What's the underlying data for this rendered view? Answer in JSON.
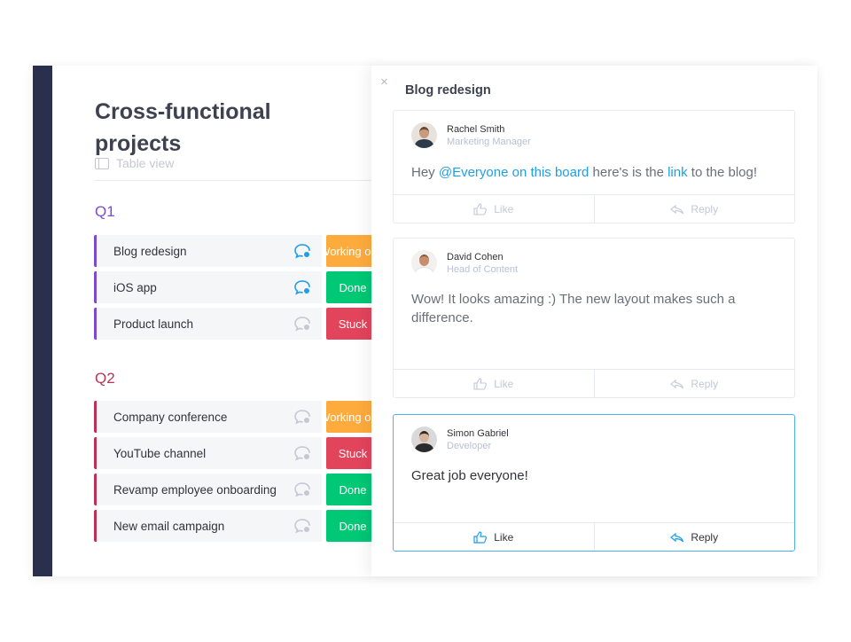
{
  "board": {
    "title": "Cross-functional projects",
    "view_label": "Table view",
    "groups": [
      {
        "title": "Q1",
        "color": "#784bd1",
        "rows": [
          {
            "name": "Blog redesign",
            "status": "Working on it",
            "status_color": "#fdab3d",
            "has_updates": true
          },
          {
            "name": "iOS app",
            "status": "Done",
            "status_color": "#00c875",
            "has_updates": true
          },
          {
            "name": "Product launch",
            "status": "Stuck",
            "status_color": "#e2445c",
            "has_updates": false
          }
        ]
      },
      {
        "title": "Q2",
        "color": "#bb3354",
        "rows": [
          {
            "name": "Company conference",
            "status": "Working on it",
            "status_color": "#fdab3d",
            "has_updates": false
          },
          {
            "name": "YouTube channel",
            "status": "Stuck",
            "status_color": "#e2445c",
            "has_updates": false
          },
          {
            "name": "Revamp employee onboarding",
            "status": "Done",
            "status_color": "#00c875",
            "has_updates": false
          },
          {
            "name": "New email campaign",
            "status": "Done",
            "status_color": "#00c875",
            "has_updates": false
          }
        ]
      }
    ]
  },
  "panel": {
    "close_icon": "×",
    "title": "Blog redesign",
    "posts": [
      {
        "author": "Rachel Smith",
        "role": "Marketing Manager",
        "text_parts": [
          "Hey ",
          "@Everyone on this board",
          " here's is the ",
          "link",
          " to the blog!"
        ],
        "like_label": "Like",
        "reply_label": "Reply"
      },
      {
        "author": "David Cohen",
        "role": "Head of Content",
        "text": "Wow! It looks amazing :) The new layout makes such a difference.",
        "like_label": "Like",
        "reply_label": "Reply"
      },
      {
        "author": "Simon Gabriel",
        "role": "Developer",
        "text": "Great job everyone!",
        "like_label": "Like",
        "reply_label": "Reply",
        "active": true
      }
    ]
  },
  "colors": {
    "sidebar": "#292f4c",
    "accent_blue": "#1c9eeb",
    "active_border": "#4db2ec"
  }
}
